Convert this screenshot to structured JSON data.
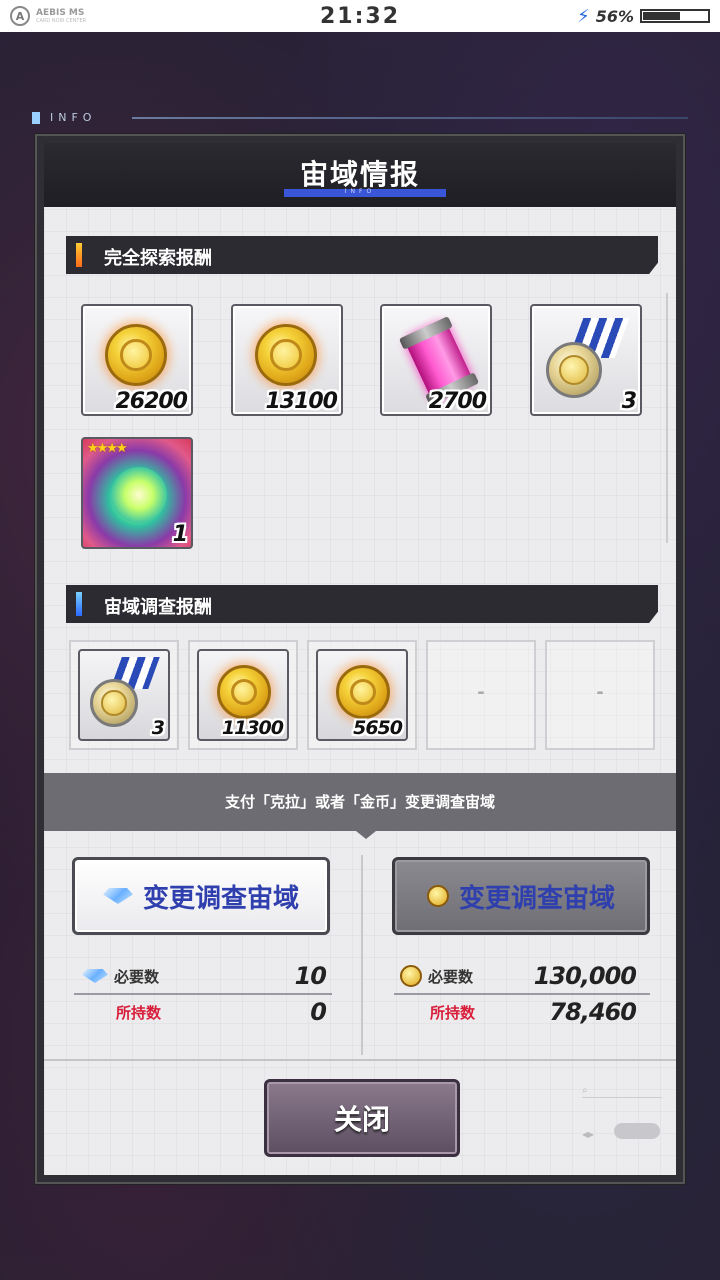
{
  "status_bar": {
    "logo_text": "AEBIS MS",
    "logo_sub": "CARD NOIR CENTER",
    "time": "21:32",
    "battery_percent": "56%",
    "battery_level": 0.56
  },
  "info_strip": {
    "label": "INFO"
  },
  "panel": {
    "title": "宙域情报",
    "subtitle": "INFO"
  },
  "full_exploration": {
    "header": "完全探索报酬",
    "rewards": [
      {
        "icon": "gold-coin-icon",
        "qty": "26200"
      },
      {
        "icon": "gold-coin-icon",
        "qty": "13100"
      },
      {
        "icon": "pink-capsule-icon",
        "qty": "2700"
      },
      {
        "icon": "medal-icon",
        "qty": "3"
      },
      {
        "icon": "rainbow-gem-card-icon",
        "qty": "1",
        "stars": "★★★★"
      }
    ]
  },
  "survey": {
    "header": "宙域调查报酬",
    "rewards": [
      {
        "icon": "medal-icon",
        "qty": "3"
      },
      {
        "icon": "gold-coin-icon",
        "qty": "11300"
      },
      {
        "icon": "gold-coin-icon",
        "qty": "5650"
      },
      {
        "empty": "-"
      },
      {
        "empty": "-"
      }
    ]
  },
  "change": {
    "notice": "支付「克拉」或者「金币」变更调查宙域",
    "left": {
      "button_label": "变更调查宙域",
      "required_label": "必要数",
      "required_value": "10",
      "owned_label": "所持数",
      "owned_value": "0"
    },
    "right": {
      "button_label": "变更调查宙域",
      "required_label": "必要数",
      "required_value": "130,000",
      "owned_label": "所持数",
      "owned_value": "78,460"
    }
  },
  "close_label": "关闭",
  "colors": {
    "accent_blue": "#3a56d8",
    "section_mark_orange": "#ff8a1a",
    "section_mark_blue": "#2a8aff",
    "owned_red": "#d81e3a"
  }
}
